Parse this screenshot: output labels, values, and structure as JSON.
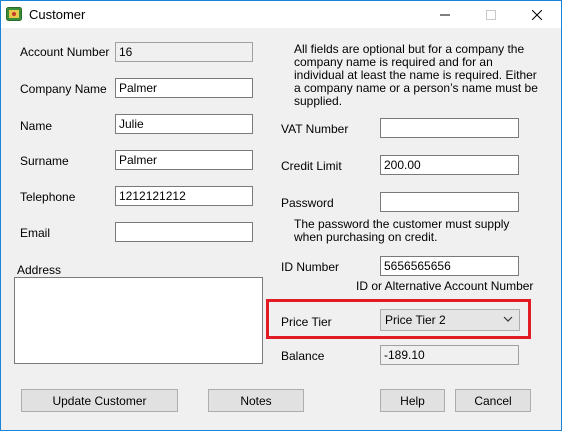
{
  "window": {
    "title": "Customer"
  },
  "left": {
    "account_number": {
      "label": "Account Number",
      "value": "16"
    },
    "company_name": {
      "label": "Company Name",
      "value": "Palmer"
    },
    "name": {
      "label": "Name",
      "value": "Julie"
    },
    "surname": {
      "label": "Surname",
      "value": "Palmer"
    },
    "telephone": {
      "label": "Telephone",
      "value": "1212121212"
    },
    "email": {
      "label": "Email",
      "value": ""
    },
    "address": {
      "label": "Address",
      "value": ""
    }
  },
  "right": {
    "info_note": "All fields are optional but for a company the company name is required and for an individual at least the name is required. Either a company name or a person’s name must be supplied.",
    "vat_number": {
      "label": "VAT Number",
      "value": ""
    },
    "credit_limit": {
      "label": "Credit Limit",
      "value": "200.00"
    },
    "password": {
      "label": "Password",
      "value": ""
    },
    "password_note": "The password the customer must supply when purchasing on credit.",
    "id_number": {
      "label": "ID Number",
      "value": "5656565656"
    },
    "id_note": "ID or Alternative Account Number",
    "price_tier": {
      "label": "Price Tier",
      "value": "Price Tier 2"
    },
    "balance": {
      "label": "Balance",
      "value": "-189.10"
    }
  },
  "buttons": {
    "update": "Update Customer",
    "notes": "Notes",
    "help": "Help",
    "cancel": "Cancel"
  },
  "colors": {
    "highlight": "#e01b24",
    "title_border": "#1883d7"
  }
}
